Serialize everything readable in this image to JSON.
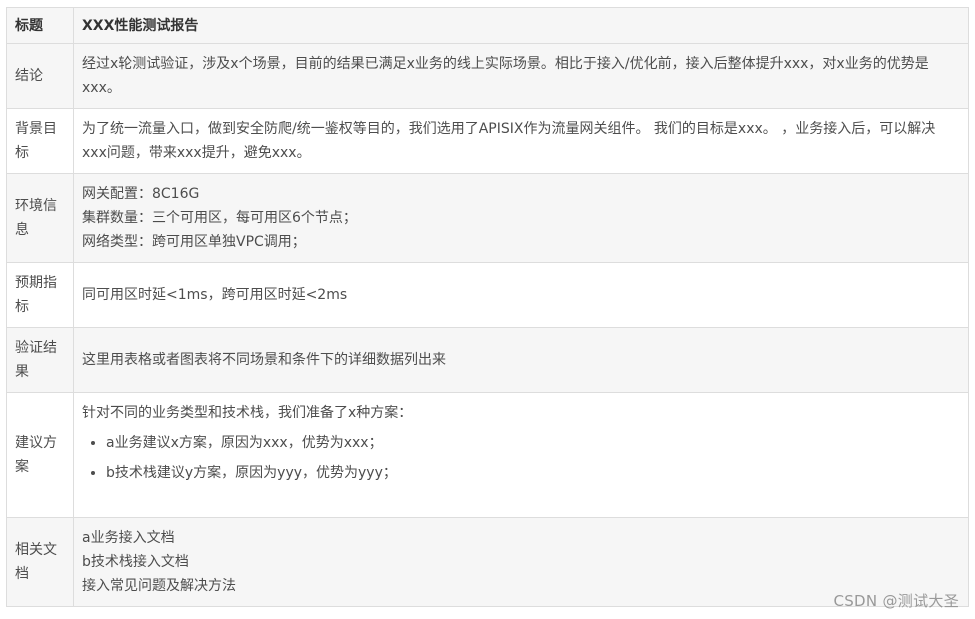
{
  "table": {
    "header": {
      "label": "标题",
      "title": "XXX性能测试报告"
    },
    "rows": [
      {
        "label": "结论",
        "text": "经过x轮测试验证，涉及x个场景，目前的结果已满足x业务的线上实际场景。相比于接入/优化前，接入后整体提升xxx，对x业务的优势是xxx。"
      },
      {
        "label": "背景目标",
        "text": "为了统一流量入口，做到安全防爬/统一鉴权等目的，我们选用了APISIX作为流量网关组件。 我们的目标是xxx。 ，业务接入后，可以解决xxx问题，带来xxx提升，避免xxx。"
      },
      {
        "label": "环境信息",
        "lines": [
          "网关配置：8C16G",
          "集群数量：三个可用区，每可用区6个节点；",
          "网络类型：跨可用区单独VPC调用；"
        ]
      },
      {
        "label": "预期指标",
        "text": "同可用区时延<1ms，跨可用区时延<2ms"
      },
      {
        "label": "验证结果",
        "text": "这里用表格或者图表将不同场景和条件下的详细数据列出来"
      },
      {
        "label": "建议方案",
        "intro": "针对不同的业务类型和技术栈，我们准备了x种方案：",
        "bullets": [
          "a业务建议x方案，原因为xxx，优势为xxx；",
          "b技术栈建议y方案，原因为yyy，优势为yyy；"
        ]
      },
      {
        "label": "相关文档",
        "lines": [
          "a业务接入文档",
          "b技术栈接入文档",
          "接入常见问题及解决方法"
        ]
      }
    ]
  },
  "watermark": "CSDN @测试大圣"
}
